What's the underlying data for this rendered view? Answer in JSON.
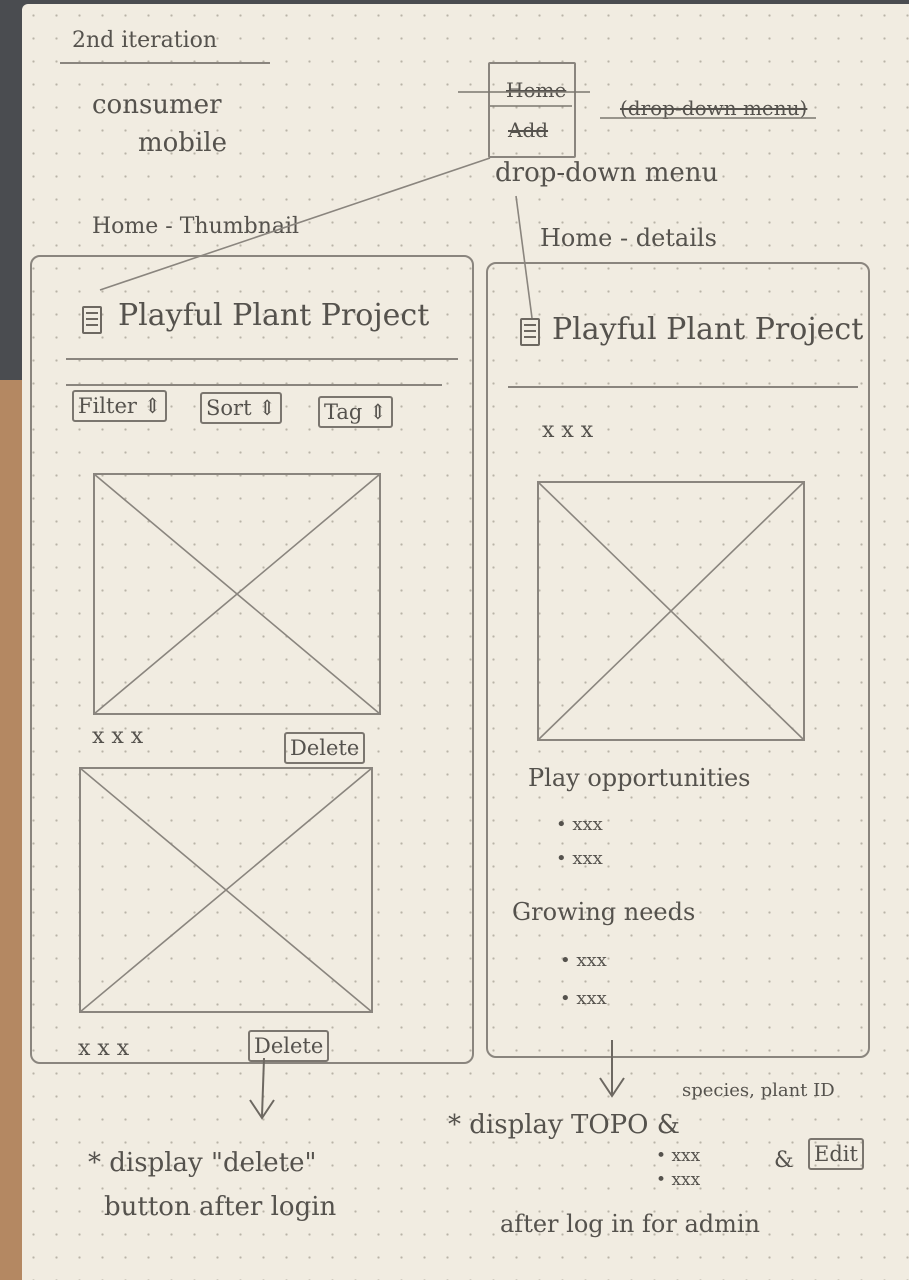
{
  "header": {
    "iteration": "2nd iteration",
    "line1": "consumer",
    "line2": "mobile"
  },
  "dropdown": {
    "item_home": "Home",
    "item_add": "Add",
    "crossed_note": "(drop-down menu)",
    "label": "drop-down menu"
  },
  "left_screen": {
    "caption": "Home - Thumbnail",
    "app_title": "Playful Plant Project",
    "filter_label": "Filter",
    "sort_label": "Sort",
    "tag_label": "Tag",
    "card1_caption": "x x x",
    "card1_delete": "Delete",
    "card2_caption": "x x x",
    "card2_delete": "Delete"
  },
  "right_screen": {
    "caption": "Home - details",
    "app_title": "Playful Plant Project",
    "item_caption": "x x x",
    "play_heading": "Play opportunities",
    "play_items": [
      "xxx",
      "xxx"
    ],
    "growing_heading": "Growing needs",
    "growing_items": [
      "xxx",
      "xxx"
    ]
  },
  "notes": {
    "left_note_line1": "* display \"delete\"",
    "left_note_line2": "button after login",
    "right_note": "* display TOPO &",
    "species": "species, plant ID",
    "sub_items": [
      "xxx",
      "xxx"
    ],
    "amp": "&",
    "edit_label": "Edit",
    "right_note_line2": "after log in for admin"
  },
  "icons": [
    "document-icon",
    "chevron-updown-icon",
    "placeholder-image-icon",
    "arrow-down-icon",
    "bullet-icon"
  ]
}
